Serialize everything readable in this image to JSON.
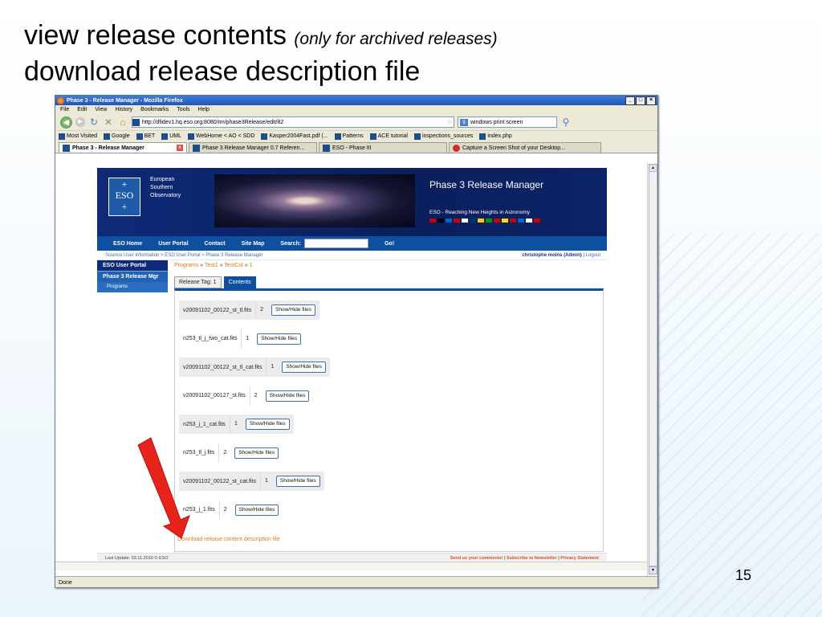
{
  "slide": {
    "title_line1": "view release contents",
    "title_note": "(only for archived releases)",
    "title_line2": "download release description file",
    "page_number": "15"
  },
  "browser": {
    "window_title": "Phase 3 - Release Manager - Mozilla Firefox",
    "menu": [
      "File",
      "Edit",
      "View",
      "History",
      "Bookmarks",
      "Tools",
      "Help"
    ],
    "url": "http://dfidev1.hq.eso.org:8080/rm/phase3Release/edit/82",
    "search_value": "windows print screen",
    "bookmarks": [
      "Most Visited",
      "Google",
      "BET",
      "UML",
      "WebHome < AO < SDD",
      "Kasper2004Fast.pdf (...",
      "Patterns",
      "ACE tutorial",
      "inspections_sources",
      "index.php"
    ],
    "tabs": [
      "Phase 3 - Release Manager",
      "Phase 3 Release Manager 0.7 Referen...",
      "ESO - Phase III",
      "Capture a Screen Shot of your Desktop..."
    ],
    "status": "Done"
  },
  "site": {
    "org_lines": [
      "European",
      "Southern",
      "Observatory"
    ],
    "logo_text": "ESO",
    "app_title": "Phase 3 Release Manager",
    "tagline": "ESO - Reaching New Heights in Astronomy",
    "nav": {
      "home": "ESO Home",
      "portal": "User Portal",
      "contact": "Contact",
      "sitemap": "Site Map",
      "search_label": "Search:",
      "go": "Go!"
    },
    "breadcrumbs": "Science User Information > ESO User Portal > Phase 3 Release Manager",
    "user": "christophe moins  (Admin)",
    "logout": "Logout",
    "side_menu": {
      "portal": "ESO User Portal",
      "manager": "Phase 3 Release Mgr",
      "programs": "Programs"
    },
    "sub_crumbs": [
      "Programs",
      "Test1",
      "TestCol",
      "1"
    ],
    "tabs": [
      "Release Tag: 1",
      "Contents"
    ],
    "files": [
      {
        "name": "v20091102_00122_st_tl.fits",
        "count": "2",
        "button": "Show/Hide files",
        "shaded": true
      },
      {
        "name": "n253_tl_j_two_cat.fits",
        "count": "1",
        "button": "Show/Hide files",
        "shaded": false
      },
      {
        "name": "v20091102_00122_st_tl_cat.fits",
        "count": "1",
        "button": "Show/Hide files",
        "shaded": true
      },
      {
        "name": "v20091102_00127_st.fits",
        "count": "2",
        "button": "Show/Hide files",
        "shaded": false
      },
      {
        "name": "n253_j_1_cat.fits",
        "count": "1",
        "button": "Show/Hide files",
        "shaded": true
      },
      {
        "name": "n253_tl_j.fits",
        "count": "2",
        "button": "Show/Hide files",
        "shaded": false
      },
      {
        "name": "v20091102_00122_st_cat.fits",
        "count": "1",
        "button": "Show/Hide files",
        "shaded": true
      },
      {
        "name": "n253_j_1.fits",
        "count": "2",
        "button": "Show/Hide files",
        "shaded": false
      }
    ],
    "download_link": "Download release content description file",
    "footer_left": "Last Update: 03.11.2010 © ESO",
    "footer_links": [
      "Send us your comments!",
      "Subscribe to Newsletter",
      "Privacy Statement"
    ]
  },
  "colors": {
    "eso_dark": "#0e2a78",
    "eso_blue": "#0e4fa0",
    "orange": "#e07b14",
    "arrow": "#e8231b"
  },
  "icons": [
    "firefox-icon",
    "back-icon",
    "forward-icon",
    "reload-icon",
    "stop-icon",
    "home-icon",
    "star-icon",
    "search-icon",
    "google-icon"
  ]
}
